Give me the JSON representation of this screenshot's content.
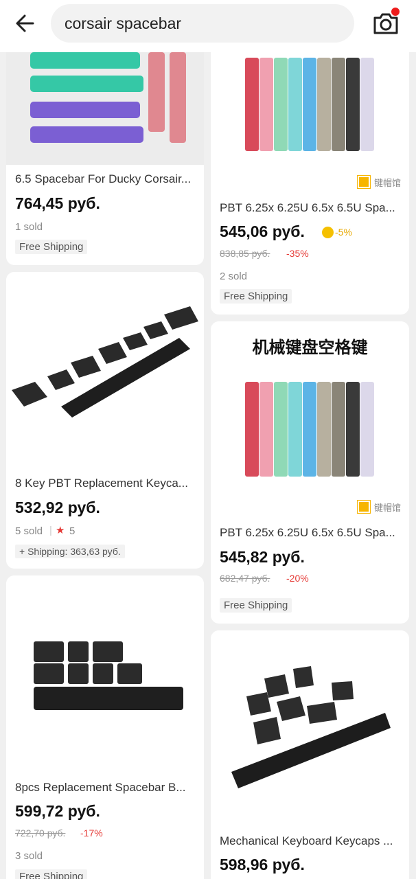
{
  "search": {
    "query": "corsair spacebar"
  },
  "icons": {
    "back": "arrow-left-icon",
    "camera": "camera-icon",
    "star": "star-icon",
    "coin": "coin-icon"
  },
  "colors": {
    "price": "#111111",
    "discount": "#e53935",
    "notification": "#ee1c1c",
    "coin": "#f5c000"
  },
  "products": [
    {
      "title": "6.5 Spacebar For Ducky Corsair...",
      "price": "764,45 руб.",
      "sold": "1 sold",
      "shipping": "Free Shipping"
    },
    {
      "title": "PBT 6.25x 6.25U 6.5x  6.5U Spa...",
      "price": "545,06 руб.",
      "coin_discount": "-5%",
      "old_price": "838,85 руб.",
      "discount": "-35%",
      "sold": "2 sold",
      "shipping": "Free Shipping",
      "shop_mark": "键帽馆"
    },
    {
      "title": "8 Key PBT Replacement Keyca...",
      "price": "532,92 руб.",
      "sold": "5 sold",
      "rating": "5",
      "shipping": "+ Shipping: 363,63 руб."
    },
    {
      "title": "PBT 6.25x 6.25U 6.5x  6.5U Spa...",
      "price": "545,82 руб.",
      "old_price": "682,47 руб.",
      "discount": "-20%",
      "shipping": "Free Shipping",
      "banner": "机械键盘空格键",
      "shop_mark": "键帽馆"
    },
    {
      "title": "8pcs Replacement Spacebar B...",
      "price": "599,72 руб.",
      "old_price": "722,70 руб.",
      "discount": "-17%",
      "sold": "3 sold",
      "shipping": "Free Shipping"
    },
    {
      "title": "Mechanical Keyboard Keycaps ...",
      "price": "598,96 руб."
    }
  ]
}
